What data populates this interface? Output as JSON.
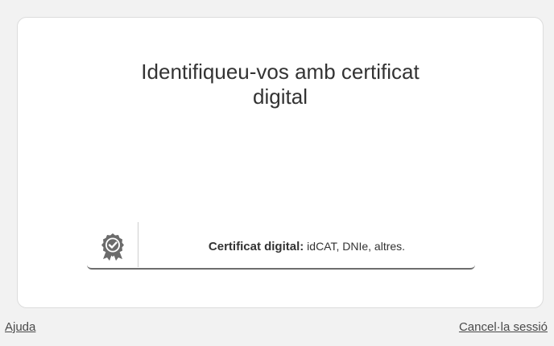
{
  "dialog": {
    "title_line1": "Identifiqueu-vos amb certificat",
    "title_line2": "digital"
  },
  "cert_option": {
    "label_bold": "Certificat digital:",
    "label_detail": "idCAT, DNIe, altres.",
    "icon": "certificate-badge-icon"
  },
  "footer": {
    "help_label": "Ajuda",
    "cancel_label": "Cancel·la sessió"
  },
  "colors": {
    "background": "#f2f2f2",
    "card": "#ffffff",
    "text": "#333333",
    "icon": "#6b6b6b"
  }
}
